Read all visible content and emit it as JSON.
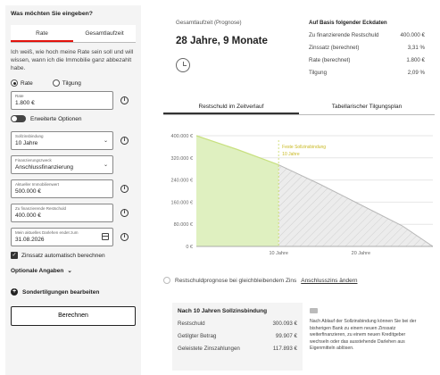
{
  "left": {
    "question": "Was möchten Sie eingeben?",
    "tabs": [
      "Rate",
      "Gesamtlaufzeit"
    ],
    "info_text": "Ich weiß, wie hoch meine Rate sein soll und will wissen, wann ich die Immobilie ganz abbezahlt habe.",
    "radio_options": [
      "Rate",
      "Tilgung"
    ],
    "rate_field": {
      "label": "Rate",
      "value": "1.800 €"
    },
    "advanced_toggle": "Erweiterte Optionen",
    "fields": [
      {
        "label": "Sollzinsbindung",
        "value": "10 Jahre",
        "kind": "select"
      },
      {
        "label": "Finanzierungszweck",
        "value": "Anschlussfinanzierung",
        "kind": "select"
      },
      {
        "label": "Aktueller Immobilienwert",
        "value": "500.000 €",
        "kind": "input"
      },
      {
        "label": "Zu finanzierende Restschuld",
        "value": "400.000 €",
        "kind": "input"
      },
      {
        "label": "Mein aktuelles Darlehen endet zum",
        "value": "31.08.2026",
        "kind": "date"
      }
    ],
    "auto_rate": "Zinssatz automatisch berechnen",
    "optional": "Optionale Angaben",
    "sondertilgungen": "Sondertilgungen bearbeiten",
    "button": "Berechnen"
  },
  "summary": {
    "laufzeit_label": "Gesamtlaufzeit (Prognose)",
    "laufzeit_value": "28 Jahre, 9 Monate",
    "eckdaten_title": "Auf Basis folgender Eckdaten",
    "eckdaten": [
      {
        "label": "Zu finanzierende Restschuld",
        "value": "400.000 €"
      },
      {
        "label": "Zinssatz (berechnet)",
        "value": "3,31 %"
      },
      {
        "label": "Rate (berechnet)",
        "value": "1.800 €"
      },
      {
        "label": "Tilgung",
        "value": "2,09 %"
      }
    ]
  },
  "tabs": [
    "Restschuld im Zeitverlauf",
    "Tabellarischer Tilgungsplan"
  ],
  "chart_data": {
    "type": "area",
    "y_ticks": [
      "400.000 €",
      "320.000 €",
      "240.000 €",
      "160.000 €",
      "80.000 €",
      "0 €"
    ],
    "x_ticks": [
      "10 Jahre",
      "20 Jahre"
    ],
    "ylim": [
      0,
      400000
    ],
    "x": [
      0,
      5,
      10,
      15,
      20,
      25,
      28.75
    ],
    "values": [
      400000,
      350000,
      295000,
      225000,
      150000,
      75000,
      0
    ],
    "annotation": [
      "Feste Sollzinsbindung",
      "10 Jahre"
    ],
    "colors": {
      "fixed": "#dff0c0",
      "fixed_line": "#c8e080",
      "rest": "#e4e4e4"
    }
  },
  "legend": {
    "text": "Restschuldprognose bei gleichbleibendem Zins",
    "link": "Anschlusszins ändern"
  },
  "after": {
    "title": "Nach 10 Jahren Sollzinsbindung",
    "rows": [
      {
        "label": "Restschuld",
        "value": "300.093 €"
      },
      {
        "label": "Getilgter Betrag",
        "value": "99.907 €"
      },
      {
        "label": "Geleistete Zinszahlungen",
        "value": "117.893 €"
      }
    ]
  },
  "note": "Nach Ablauf der Sollzinsbindung können Sie bei der bisherigen Bank zu einem neuen Zinssatz weiterfinanzieren, zu einem neuen Kreditgeber wechseln oder das ausstehende Darlehen aus Eigenmitteln ablösen."
}
